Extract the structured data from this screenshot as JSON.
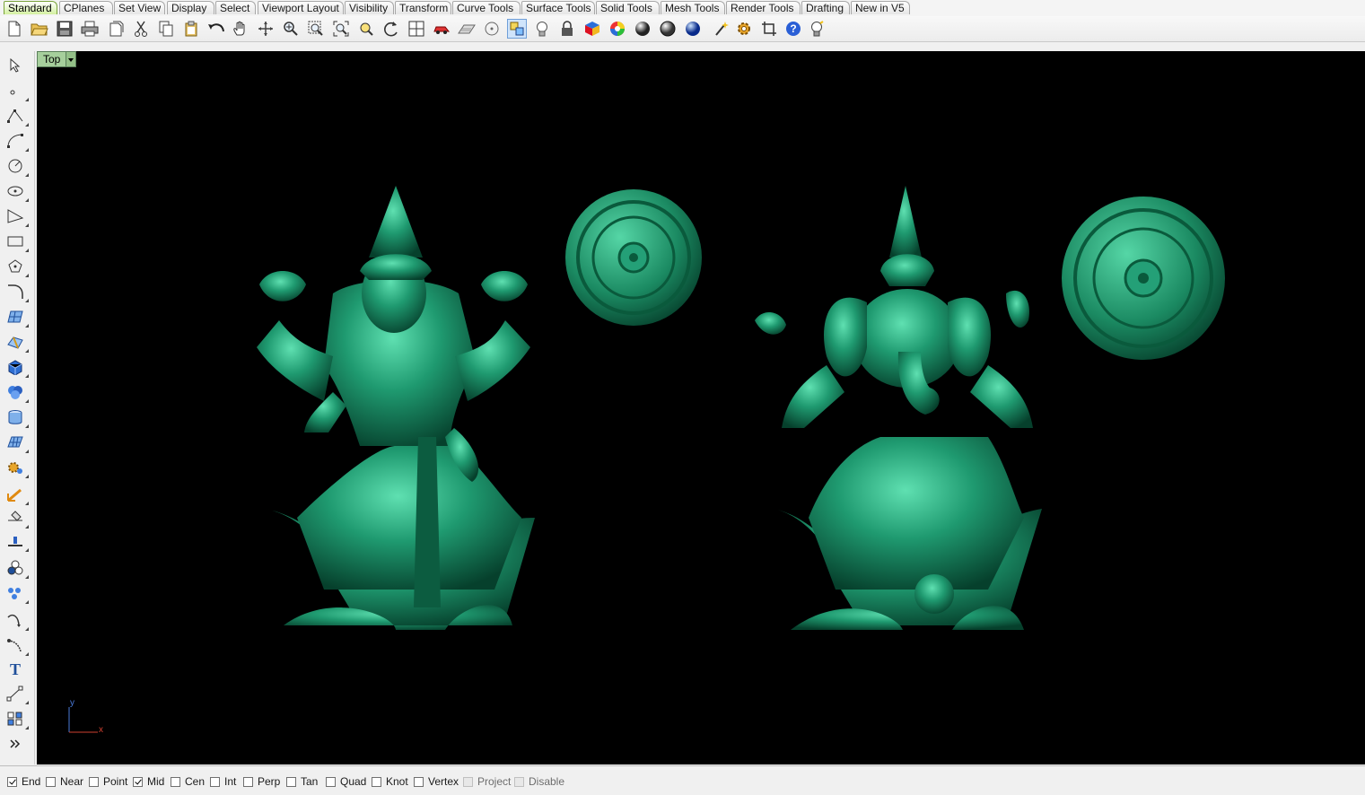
{
  "tabs": [
    {
      "label": "Standard",
      "active": true
    },
    {
      "label": "CPlanes"
    },
    {
      "label": "Set View"
    },
    {
      "label": "Display"
    },
    {
      "label": "Select"
    },
    {
      "label": "Viewport Layout"
    },
    {
      "label": "Visibility"
    },
    {
      "label": "Transform"
    },
    {
      "label": "Curve Tools"
    },
    {
      "label": "Surface Tools"
    },
    {
      "label": "Solid Tools"
    },
    {
      "label": "Mesh Tools"
    },
    {
      "label": "Render Tools"
    },
    {
      "label": "Drafting"
    },
    {
      "label": "New in V5"
    }
  ],
  "toolbar_icons": [
    "new-icon",
    "open-icon",
    "save-icon",
    "print-icon",
    "paste-from-file-icon",
    "cut-icon",
    "copy-icon",
    "paste-icon",
    "undo-icon",
    "pan-hand-icon",
    "rotate-view-icon",
    "zoom-dynamic-icon",
    "zoom-window-icon",
    "zoom-extents-icon",
    "zoom-selected-icon",
    "rotate-icon",
    "four-viewports-icon",
    "car-render-icon",
    "grid-plane-icon",
    "circle-object-icon",
    "select-objects-icon",
    "light-bulb-icon",
    "lock-icon",
    "material-book-icon",
    "color-wheel-icon",
    "shaded-sphere-icon",
    "rendered-sphere-icon",
    "blue-sphere-icon",
    "wizard-icon",
    "settings-gear-icon",
    "crop-frame-icon",
    "help-icon",
    "hint-bulb-icon"
  ],
  "left_tools": [
    "select-arrow-icon",
    "point-icon",
    "polyline-icon",
    "curve-icon",
    "circle-icon",
    "ellipse-icon",
    "arc-icon",
    "rectangle-icon",
    "polygon-icon",
    "fillet-curve-icon",
    "surface-from-points-icon",
    "extrude-surface-icon",
    "box-solid-icon",
    "solid-union-icon",
    "cylinder-icon",
    "mesh-icon",
    "solid-tools-icon",
    "gumball-icon",
    "split-icon",
    "trim-icon",
    "boolean-icon",
    "array-icon",
    "curve-from-object-icon",
    "sweep-icon",
    "text-icon",
    "dimension-icon",
    "block-icon",
    "more-tools-icon"
  ],
  "viewport": {
    "name": "Top",
    "background": "#000000",
    "model_color": "#1f8f6b",
    "axis_y": "y",
    "axis_x": "x"
  },
  "osnaps": [
    {
      "label": "End",
      "checked": true
    },
    {
      "label": "Near",
      "checked": false
    },
    {
      "label": "Point",
      "checked": false
    },
    {
      "label": "Mid",
      "checked": true
    },
    {
      "label": "Cen",
      "checked": false
    },
    {
      "label": "Int",
      "checked": false
    },
    {
      "label": "Perp",
      "checked": false
    },
    {
      "label": "Tan",
      "checked": false
    },
    {
      "label": "Quad",
      "checked": false
    },
    {
      "label": "Knot",
      "checked": false
    },
    {
      "label": "Vertex",
      "checked": false
    },
    {
      "label": "Project",
      "checked": false,
      "disabled": true
    },
    {
      "label": "Disable",
      "checked": false,
      "disabled": true
    }
  ]
}
